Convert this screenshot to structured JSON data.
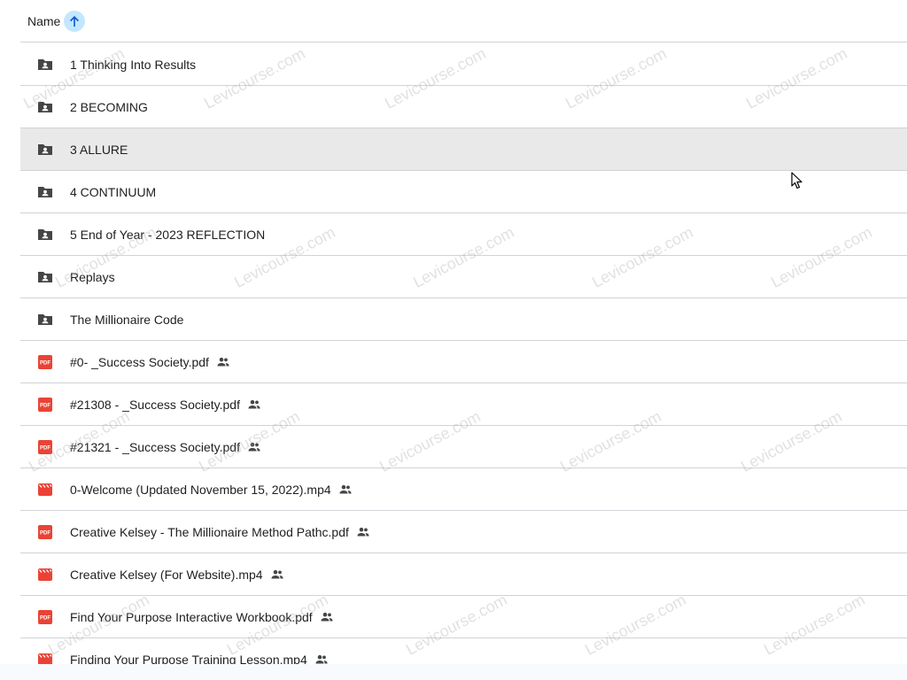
{
  "header": {
    "name_label": "Name",
    "sort_icon": "arrow-up-icon"
  },
  "rows": [
    {
      "name": "1 Thinking Into Results",
      "type": "shared-folder",
      "icon": "shared-folder-icon",
      "shared": false,
      "selected": false
    },
    {
      "name": "2 BECOMING",
      "type": "shared-folder",
      "icon": "shared-folder-icon",
      "shared": false,
      "selected": false
    },
    {
      "name": "3 ALLURE",
      "type": "shared-folder",
      "icon": "shared-folder-icon",
      "shared": false,
      "selected": true
    },
    {
      "name": "4 CONTINUUM",
      "type": "shared-folder",
      "icon": "shared-folder-icon",
      "shared": false,
      "selected": false
    },
    {
      "name": "5 End of Year - 2023 REFLECTION",
      "type": "shared-folder",
      "icon": "shared-folder-icon",
      "shared": false,
      "selected": false
    },
    {
      "name": "Replays",
      "type": "shared-folder",
      "icon": "shared-folder-icon",
      "shared": false,
      "selected": false
    },
    {
      "name": "The Millionaire Code",
      "type": "shared-folder",
      "icon": "shared-folder-icon",
      "shared": false,
      "selected": false
    },
    {
      "name": "#0- _Success Society.pdf",
      "type": "pdf",
      "icon": "pdf-icon",
      "shared": true,
      "selected": false
    },
    {
      "name": "#21308 - _Success Society.pdf",
      "type": "pdf",
      "icon": "pdf-icon",
      "shared": true,
      "selected": false
    },
    {
      "name": "#21321 - _Success Society.pdf",
      "type": "pdf",
      "icon": "pdf-icon",
      "shared": true,
      "selected": false
    },
    {
      "name": "0-Welcome (Updated November 15, 2022).mp4",
      "type": "video",
      "icon": "video-icon",
      "shared": true,
      "selected": false
    },
    {
      "name": "Creative Kelsey - The Millionaire Method Pathc.pdf",
      "type": "pdf",
      "icon": "pdf-icon",
      "shared": true,
      "selected": false
    },
    {
      "name": "Creative Kelsey (For Website).mp4",
      "type": "video",
      "icon": "video-icon",
      "shared": true,
      "selected": false
    },
    {
      "name": "Find Your Purpose Interactive Workbook.pdf",
      "type": "pdf",
      "icon": "pdf-icon",
      "shared": true,
      "selected": false
    },
    {
      "name": "Finding Your Purpose Training Lesson.mp4",
      "type": "video",
      "icon": "video-icon",
      "shared": true,
      "selected": false
    }
  ],
  "watermark_text": "Levicourse.com",
  "colors": {
    "folder": "#444746",
    "pdf": "#ea4335",
    "video": "#ea4335",
    "selected_row": "#e9e9e9",
    "sort_button": "#c2e7ff",
    "divider": "#d0d3d8"
  }
}
